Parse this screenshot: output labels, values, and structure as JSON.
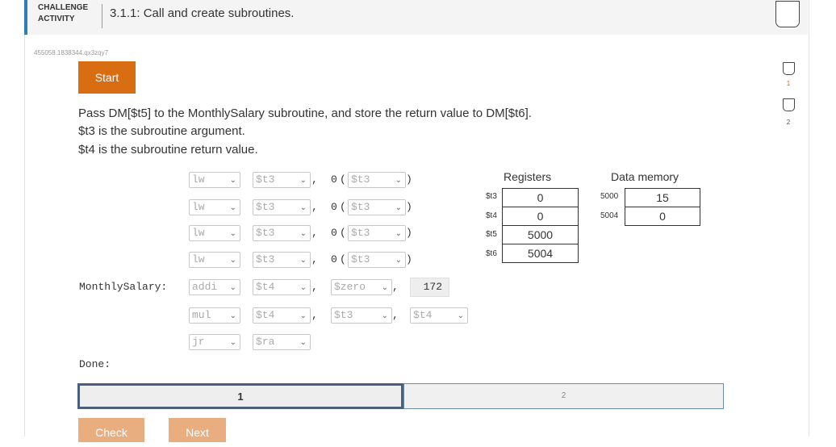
{
  "header": {
    "label_line1": "CHALLENGE",
    "label_line2": "ACTIVITY",
    "title": "3.1.1: Call and create subroutines."
  },
  "activity_id": "455058.1838344.qx3zqy7",
  "start_label": "Start",
  "instructions": [
    "Pass DM[$t5] to the MonthlySalary subroutine, and store the return value to DM[$t6].",
    "$t3 is the subroutine argument.",
    "$t4 is the subroutine return value."
  ],
  "code": {
    "rows": [
      {
        "label": "",
        "op": "lw",
        "a": "$t3",
        "sep": ",",
        "offset": "0",
        "paren_open": "(",
        "b": "$t3",
        "paren_close": ")"
      },
      {
        "label": "",
        "op": "lw",
        "a": "$t3",
        "sep": ",",
        "offset": "0",
        "paren_open": "(",
        "b": "$t3",
        "paren_close": ")"
      },
      {
        "label": "",
        "op": "lw",
        "a": "$t3",
        "sep": ",",
        "offset": "0",
        "paren_open": "(",
        "b": "$t3",
        "paren_close": ")"
      },
      {
        "label": "",
        "op": "lw",
        "a": "$t3",
        "sep": ",",
        "offset": "0",
        "paren_open": "(",
        "b": "$t3",
        "paren_close": ")"
      }
    ],
    "monthly_label": "MonthlySalary:",
    "addi": {
      "op": "addi",
      "a": "$t4",
      "sep1": ",",
      "b": "$zero",
      "sep2": ",",
      "imm": "172"
    },
    "mul": {
      "op": "mul",
      "a": "$t4",
      "sep1": ",",
      "b": "$t3",
      "sep2": ",",
      "c": "$t4"
    },
    "jr": {
      "op": "jr",
      "a": "$ra"
    },
    "done_label": "Done:"
  },
  "registers": {
    "title": "Registers",
    "rows": [
      {
        "name": "$t3",
        "value": "0"
      },
      {
        "name": "$t4",
        "value": "0"
      },
      {
        "name": "$t5",
        "value": "5000"
      },
      {
        "name": "$t6",
        "value": "5004"
      }
    ]
  },
  "data_memory": {
    "title": "Data memory",
    "rows": [
      {
        "address": "5000",
        "value": "15"
      },
      {
        "address": "5004",
        "value": "0"
      }
    ]
  },
  "progress": {
    "segments": [
      {
        "label": "1",
        "active": true
      },
      {
        "label": "2",
        "active": false
      }
    ]
  },
  "buttons": {
    "check": "Check",
    "next": "Next"
  },
  "side_levels": [
    {
      "label": "1"
    },
    {
      "label": "2"
    }
  ],
  "colors": {
    "accent": "#d96d11",
    "header_border": "#2f7fb7",
    "progress_active_border": "#4a5f7a",
    "progress_inactive_border": "#6a8bb0",
    "button_disabled": "#e9ae80"
  }
}
